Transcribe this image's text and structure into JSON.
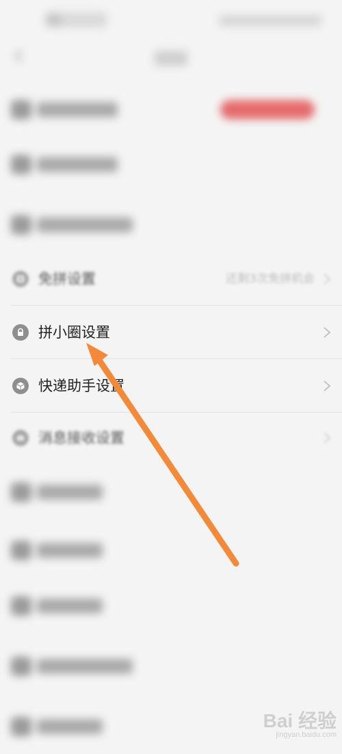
{
  "rows": [
    {
      "id": "free-group",
      "label": "免拼设置",
      "right_text": "还剩3次免拼机会",
      "icon": "free-group-icon"
    },
    {
      "id": "circle",
      "label": "拼小圈设置",
      "icon": "lock-icon"
    },
    {
      "id": "express",
      "label": "快递助手设置",
      "icon": "package-icon"
    },
    {
      "id": "message",
      "label": "消息接收设置",
      "icon": "mail-icon"
    }
  ],
  "watermark": {
    "main": "Bai 经验",
    "sub": "jingyan.baidu.com"
  },
  "colors": {
    "accent_arrow": "#f28a3a",
    "red_badge": "#e56b6b"
  }
}
